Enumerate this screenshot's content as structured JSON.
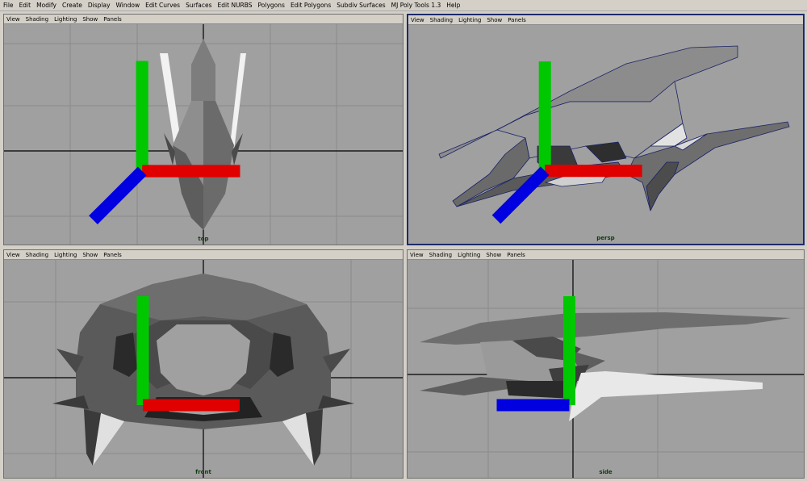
{
  "menubar": {
    "items": [
      "File",
      "Edit",
      "Modify",
      "Create",
      "Display",
      "Window",
      "Edit Curves",
      "Surfaces",
      "Edit NURBS",
      "Polygons",
      "Edit Polygons",
      "Subdiv Surfaces",
      "MJ Poly Tools 1.3",
      "Help"
    ]
  },
  "panel_menu": [
    "View",
    "Shading",
    "Lighting",
    "Show",
    "Panels"
  ],
  "viewports": {
    "top": {
      "camera": "top"
    },
    "persp": {
      "camera": "persp"
    },
    "front": {
      "camera": "front"
    },
    "side": {
      "camera": "side"
    }
  },
  "axis_labels": {
    "x": "x",
    "y": "y",
    "z": "z"
  },
  "colors": {
    "viewport_bg": "#a0a0a0",
    "grid": "#8a8a8a",
    "axis": "#000000",
    "active_border": "#1c2b6a",
    "wire": "#1a2266"
  }
}
